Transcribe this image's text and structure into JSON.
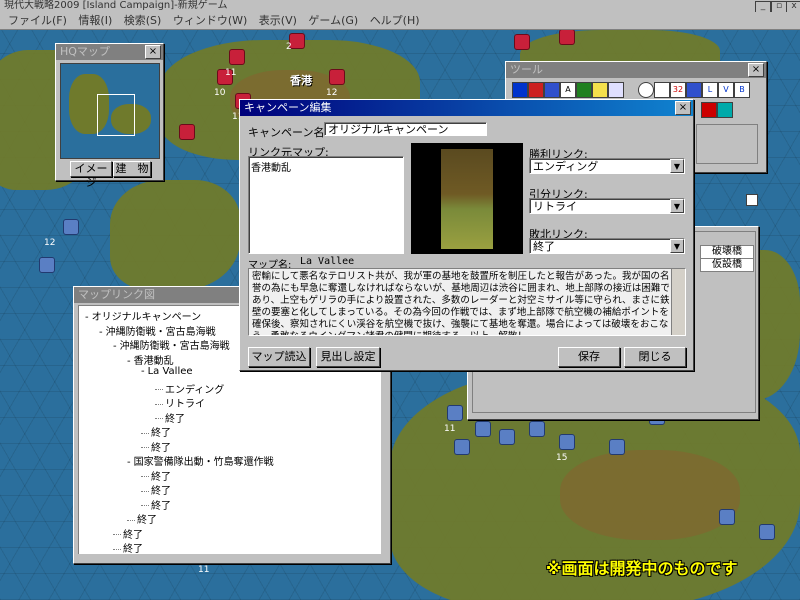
{
  "app": {
    "title": "現代大戦略2009 [Island Campaign]-新規ゲーム",
    "menu": [
      "ファイル(F)",
      "情報(I)",
      "検索(S)",
      "ウィンドウ(W)",
      "表示(V)",
      "ゲーム(G)",
      "ヘルプ(H)"
    ],
    "window_buttons": [
      "_",
      "▫",
      "x"
    ]
  },
  "map": {
    "unit_labels": [
      "2",
      "11",
      "10",
      "12",
      "11",
      "12",
      "11",
      "15",
      "11"
    ],
    "place_name": "香港"
  },
  "hq_window": {
    "title": "HQマップ",
    "buttons": [
      "イメージ",
      "建　物"
    ]
  },
  "tool_window": {
    "title": "ツール",
    "icons": [
      "A",
      "L",
      "V",
      "B",
      "32"
    ]
  },
  "info_window": {
    "rows": [
      "破壊橋",
      "仮設橋"
    ]
  },
  "campaign_tree_window": {
    "title": "マップリンク図",
    "nodes": [
      {
        "text": "オリジナルキャンペーン",
        "level": 0,
        "exp": "-"
      },
      {
        "text": "沖縄防衛戦・宮古島海戦",
        "level": 1,
        "exp": "-"
      },
      {
        "text": "沖縄防衛戦・宮古島海戦",
        "level": 2,
        "exp": "-"
      },
      {
        "text": "香港動乱",
        "level": 3,
        "exp": "-"
      },
      {
        "text": "La Vallee",
        "level": 4,
        "exp": "-"
      },
      {
        "text": "エンディング",
        "level": 5,
        "exp": ""
      },
      {
        "text": "リトライ",
        "level": 5,
        "exp": ""
      },
      {
        "text": "終了",
        "level": 5,
        "exp": ""
      },
      {
        "text": "終了",
        "level": 4,
        "exp": ""
      },
      {
        "text": "終了",
        "level": 4,
        "exp": ""
      },
      {
        "text": "国家警備隊出動・竹島奪還作戦",
        "level": 3,
        "exp": "-"
      },
      {
        "text": "終了",
        "level": 4,
        "exp": ""
      },
      {
        "text": "終了",
        "level": 4,
        "exp": ""
      },
      {
        "text": "終了",
        "level": 4,
        "exp": ""
      },
      {
        "text": "終了",
        "level": 3,
        "exp": ""
      },
      {
        "text": "終了",
        "level": 2,
        "exp": ""
      },
      {
        "text": "終了",
        "level": 2,
        "exp": ""
      }
    ]
  },
  "campaign_edit": {
    "title": "キャンペーン編集",
    "name_label": "キャンペーン名:",
    "name_value": "オリジナルキャンペーン",
    "link_map_label": "リンク元マップ:",
    "link_map_value": "香港動乱",
    "win_label": "勝利リンク:",
    "win_value": "エンディング",
    "draw_label": "引分リンク:",
    "draw_value": "リトライ",
    "lose_label": "敗北リンク:",
    "lose_value": "終了",
    "map_name_label": "マップ名:",
    "map_name_value": "La Vallee",
    "briefing": "密輸にして悪名なテロリスト共が、我が軍の基地を鼓置所を制圧したと報告があった。我が国の名誉の為にも早急に奪還しなければならないが、基地周辺は渋谷に囲まれ、地上部隊の接近は困難であり、上空もゲリラの手により設置された、多数のレーダーと対空ミサイル等に守られ、まさに鉄壁の要塞と化してしまっている。その為今回の作戦では、まず地上部隊で航空機の補給ポイントを確保後、察知されにくい渓谷を航空機で抜け、強襲にて基地を奪還。場合によっては破壊をおこなう。勇敢なるウイングマン諸君の健闘に期待する。以上、解散！",
    "buttons": {
      "load_map": "マップ読込",
      "heading": "見出し設定",
      "save": "保存",
      "close": "閉じる"
    }
  },
  "footer_caption": "※画面は開発中のものです"
}
